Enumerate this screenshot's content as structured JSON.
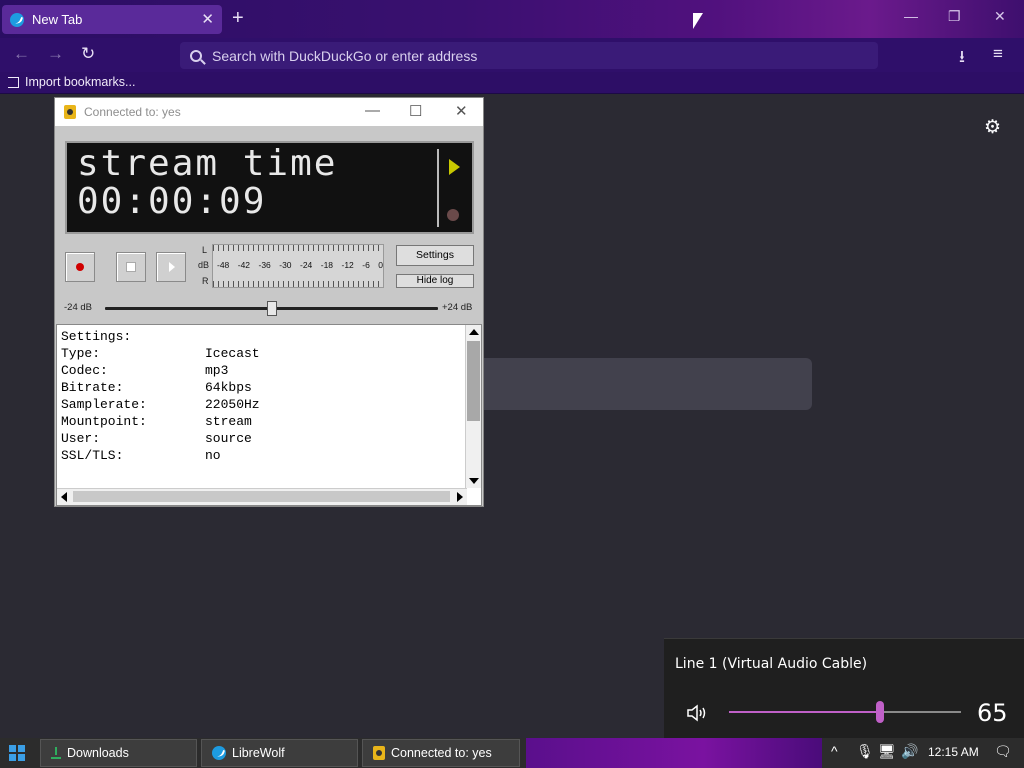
{
  "browser": {
    "tab": {
      "title": "New Tab"
    },
    "new_tab": "+",
    "window_controls": {
      "minimize": "—",
      "restore": "❐",
      "close": "✕"
    },
    "urlbar": {
      "placeholder": "Search with DuckDuckGo or enter address"
    },
    "bookmarks": {
      "import": "Import bookmarks..."
    }
  },
  "butt": {
    "title": "Connected to: yes",
    "lcd": {
      "line1": "stream time",
      "line2": "00:00:09"
    },
    "vu": {
      "l": "L",
      "db": "dB",
      "r": "R",
      "scale": [
        "-48",
        "-42",
        "-36",
        "-30",
        "-24",
        "-18",
        "-12",
        "-6",
        "0"
      ]
    },
    "buttons": {
      "settings": "Settings",
      "hide_log": "Hide log"
    },
    "gain": {
      "min_label": "-24 dB",
      "max_label": "+24 dB",
      "value_db": 0
    },
    "log": [
      {
        "key": "Settings:",
        "value": ""
      },
      {
        "key": "Type:",
        "value": "Icecast"
      },
      {
        "key": "Codec:",
        "value": "mp3"
      },
      {
        "key": "Bitrate:",
        "value": "64kbps"
      },
      {
        "key": "Samplerate:",
        "value": "22050Hz"
      },
      {
        "key": "Mountpoint:",
        "value": "stream"
      },
      {
        "key": "User:",
        "value": "source"
      },
      {
        "key": "SSL/TLS:",
        "value": "no"
      }
    ]
  },
  "volume": {
    "device": "Line 1 (Virtual Audio Cable)",
    "value": "65",
    "level": 0.65
  },
  "taskbar": {
    "items": {
      "downloads": "Downloads",
      "librewolf": "LibreWolf",
      "butt": "Connected to: yes"
    },
    "clock": "12:15 AM"
  },
  "colors": {
    "accent": "#c060c8",
    "rec": "#d00000"
  }
}
